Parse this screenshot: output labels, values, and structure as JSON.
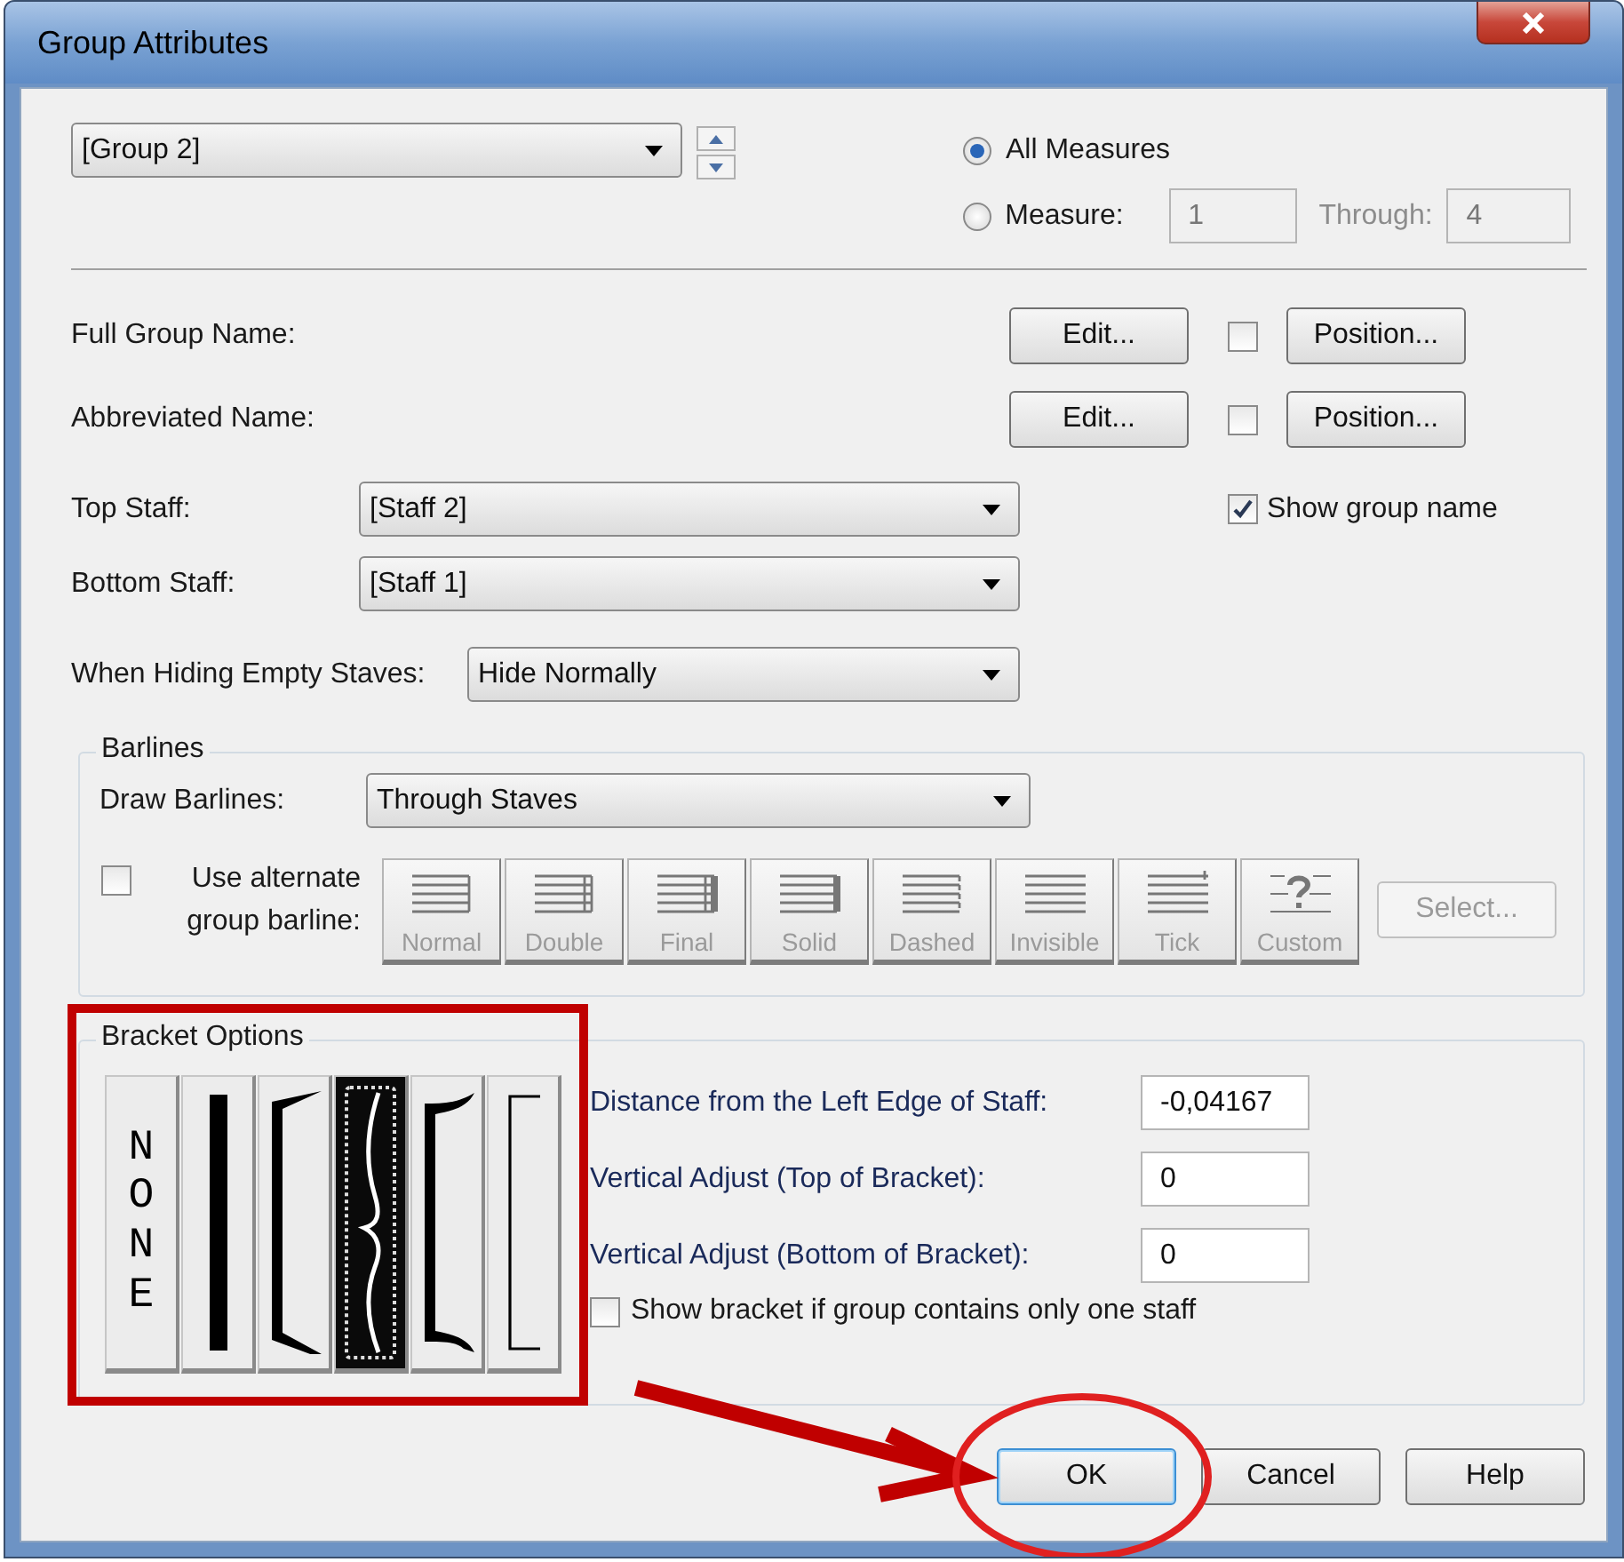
{
  "window": {
    "title": "Group Attributes"
  },
  "group_select": {
    "value": "[Group 2]"
  },
  "measure_scope": [
    {
      "label": "All Measures",
      "selected": true
    },
    {
      "label": "Measure:",
      "selected": false
    }
  ],
  "measure_range": {
    "from": "1",
    "through_label": "Through:",
    "to": "4",
    "disabled": true
  },
  "name_rows": [
    {
      "label": "Full Group Name:",
      "edit": "Edit...",
      "checked": false,
      "position": "Position..."
    },
    {
      "label": "Abbreviated Name:",
      "edit": "Edit...",
      "checked": false,
      "position": "Position..."
    }
  ],
  "staff_rows": [
    {
      "label": "Top Staff:",
      "value": "[Staff 2]"
    },
    {
      "label": "Bottom Staff:",
      "value": "[Staff 1]"
    }
  ],
  "show_group_name": {
    "label": "Show group name",
    "checked": true
  },
  "hiding": {
    "label": "When Hiding Empty Staves:",
    "value": "Hide Normally"
  },
  "barlines": {
    "title": "Barlines",
    "draw_label": "Draw Barlines:",
    "draw_value": "Through Staves",
    "alternate": {
      "label": "Use alternate group barline:",
      "checked": false
    },
    "styles": [
      {
        "kind": "normal",
        "label": "Normal",
        "disabled": true
      },
      {
        "kind": "double",
        "label": "Double",
        "disabled": true
      },
      {
        "kind": "final",
        "label": "Final",
        "disabled": true
      },
      {
        "kind": "solid",
        "label": "Solid",
        "disabled": true
      },
      {
        "kind": "dashed",
        "label": "Dashed",
        "disabled": true
      },
      {
        "kind": "invisible",
        "label": "Invisible",
        "disabled": true
      },
      {
        "kind": "tick",
        "label": "Tick",
        "disabled": true
      },
      {
        "kind": "custom",
        "label": "Custom",
        "disabled": true
      }
    ],
    "select": {
      "label": "Select...",
      "disabled": true
    }
  },
  "bracket_options": {
    "title": "Bracket Options",
    "styles": [
      {
        "kind": "none",
        "label": "NONE",
        "selected": false
      },
      {
        "kind": "line",
        "selected": false
      },
      {
        "kind": "bracket",
        "selected": false
      },
      {
        "kind": "brace",
        "selected": true
      },
      {
        "kind": "hooked",
        "selected": false
      },
      {
        "kind": "plain",
        "selected": false
      }
    ],
    "fields": [
      {
        "label": "Distance from the Left Edge of Staff:",
        "value": "-0,04167"
      },
      {
        "label": "Vertical Adjust (Top of Bracket):",
        "value": "0"
      },
      {
        "label": "Vertical Adjust (Bottom of Bracket):",
        "value": "0"
      }
    ],
    "single_staff": {
      "label": "Show bracket if group contains only one staff",
      "checked": false
    }
  },
  "buttons": [
    {
      "label": "OK",
      "default": true
    },
    {
      "label": "Cancel",
      "default": false
    },
    {
      "label": "Help",
      "default": false
    }
  ]
}
